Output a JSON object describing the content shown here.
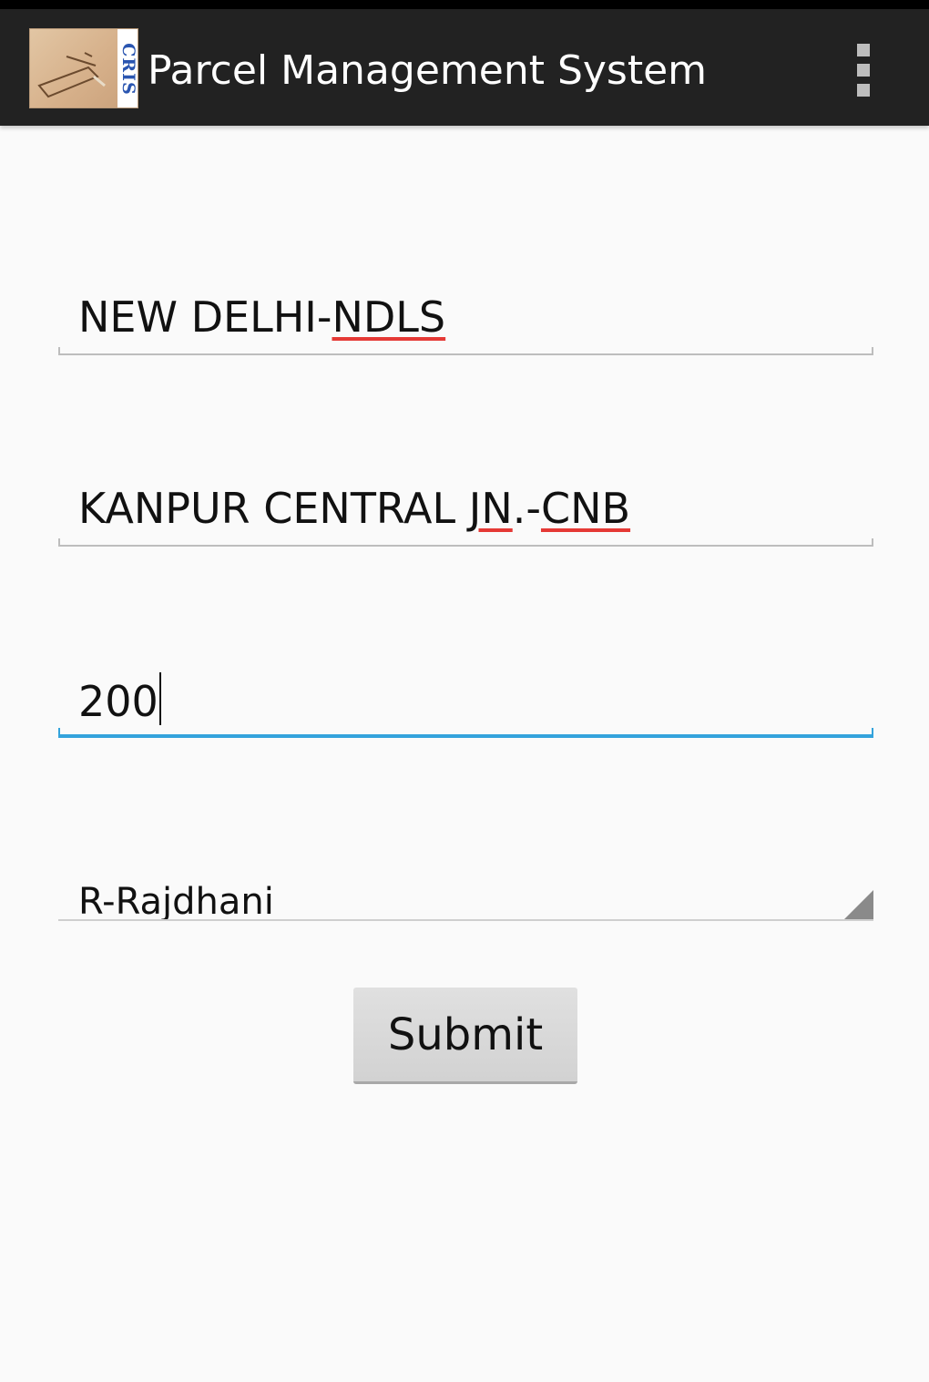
{
  "action_bar": {
    "title": "Parcel Management System",
    "logo_text": "CRIS",
    "logo_icon": "parcel-logo-icon",
    "menu_icon": "overflow-menu-icon",
    "background_color": "#222222"
  },
  "form": {
    "from_station": {
      "name": "NEW DELHI",
      "sep": "-",
      "code": "NDLS"
    },
    "to_station": {
      "name": "KANPUR CENTRAL",
      "sep": " ",
      "part2": "JN",
      "sep2": ".-",
      "code": "CNB"
    },
    "weight": "200",
    "train_type": {
      "selected": "R-Rajdhani",
      "icon": "dropdown-arrow-icon"
    },
    "submit_label": "Submit"
  },
  "colors": {
    "focus_accent": "#33a3dc",
    "spellcheck": "#e53935"
  }
}
